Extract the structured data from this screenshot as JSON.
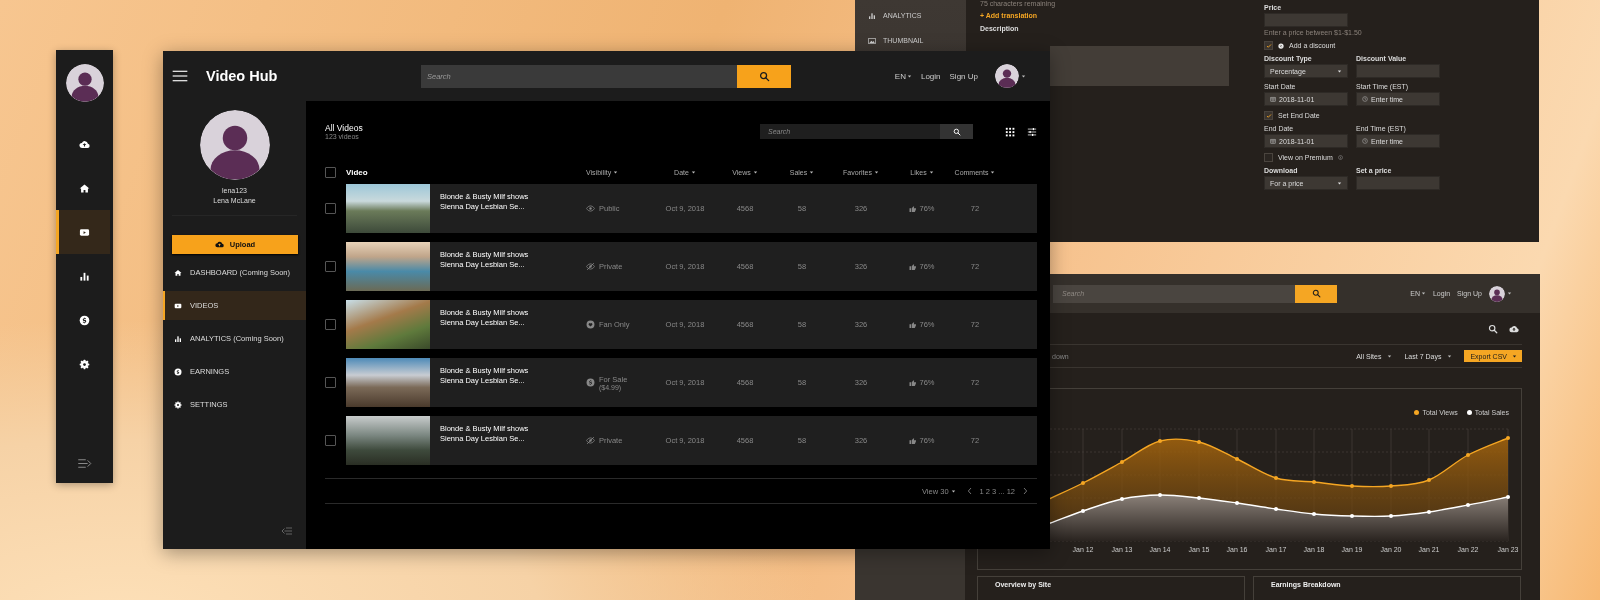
{
  "mini_sidebar": {
    "items": [
      {
        "kind": "upload",
        "selected": false
      },
      {
        "kind": "home",
        "selected": false
      },
      {
        "kind": "video",
        "selected": true
      },
      {
        "kind": "chart",
        "selected": false
      },
      {
        "kind": "earnings",
        "selected": false
      },
      {
        "kind": "settings",
        "selected": false
      }
    ]
  },
  "main": {
    "title": "Video Hub",
    "search": {
      "placeholder": "Search"
    },
    "language": "EN",
    "login": "Login",
    "signup": "Sign Up",
    "profile": {
      "username": "lena123",
      "name": "Lena McLane"
    },
    "upload_button": "Upload",
    "nav": [
      {
        "kind": "home",
        "label": "DASHBOARD (Coming Soon)",
        "selected": false
      },
      {
        "kind": "video",
        "label": "VIDEOS",
        "selected": true
      },
      {
        "kind": "chart",
        "label": "ANALYTICS  (Coming Soon)",
        "selected": false
      },
      {
        "kind": "earnings",
        "label": "EARNINGS",
        "selected": false
      },
      {
        "kind": "settings",
        "label": "SETTINGS",
        "selected": false
      }
    ],
    "list": {
      "title": "All Videos",
      "count": "123 videos",
      "search": {
        "placeholder": "Search"
      }
    },
    "table": {
      "columns": [
        "Video",
        "Visibility",
        "Date",
        "Views",
        "Sales",
        "Favorites",
        "Likes",
        "Comments"
      ],
      "header_checked": false,
      "rows": [
        {
          "checked": false,
          "title": [
            "Blonde & Busty Milf shows",
            "Sienna Day Lesbian Se..."
          ],
          "kind": "public",
          "visibility": "Public",
          "date": "Oct 9, 2018",
          "views": "4568",
          "sales": "58",
          "favorites": "326",
          "likes": "76%",
          "comments": "72"
        },
        {
          "checked": false,
          "title": [
            "Blonde & Busty Milf shows",
            "Sienna Day Lesbian Se..."
          ],
          "kind": "private",
          "visibility": "Private",
          "date": "Oct 9, 2018",
          "views": "4568",
          "sales": "58",
          "favorites": "326",
          "likes": "76%",
          "comments": "72"
        },
        {
          "checked": false,
          "title": [
            "Blonde & Busty Milf shows",
            "Sienna Day Lesbian Se..."
          ],
          "kind": "fan",
          "visibility": "Fan Only",
          "date": "Oct 9, 2018",
          "views": "4568",
          "sales": "58",
          "favorites": "326",
          "likes": "76%",
          "comments": "72"
        },
        {
          "checked": false,
          "title": [
            "Blonde & Busty Milf shows",
            "Sienna Day Lesbian Se..."
          ],
          "kind": "sale",
          "visibility": "For Sale",
          "price": "($4.99)",
          "date": "Oct 9, 2018",
          "views": "4568",
          "sales": "58",
          "favorites": "326",
          "likes": "76%",
          "comments": "72"
        },
        {
          "checked": false,
          "title": [
            "Blonde & Busty Milf shows",
            "Sienna Day Lesbian Se..."
          ],
          "kind": "private",
          "visibility": "Private",
          "date": "Oct 9, 2018",
          "views": "4568",
          "sales": "58",
          "favorites": "326",
          "likes": "76%",
          "comments": "72"
        }
      ]
    },
    "pagination": {
      "view": "View 30",
      "pages": "1 2 3 ... 12"
    }
  },
  "form": {
    "nav": [
      {
        "kind": "chart",
        "label": "ANALYTICS"
      },
      {
        "kind": "image",
        "label": "THUMBNAIL"
      }
    ],
    "chars_remaining": "75 characters remaining",
    "add_translation": "+ Add translation",
    "description_label": "Description",
    "price_label": "Price",
    "price_hint": "Enter a price between $1-$1.50",
    "discount": {
      "checked": true,
      "label": "Add a discount"
    },
    "discount_type": {
      "label": "Discount Type",
      "value": "Percentage"
    },
    "discount_value": {
      "label": "Discount Value"
    },
    "start_date": {
      "label": "Start Date",
      "value": "2018-11-01"
    },
    "start_time": {
      "label": "Start Time (EST)",
      "placeholder": "Enter time"
    },
    "end_toggle": {
      "checked": true,
      "label": "Set End Date"
    },
    "end_date": {
      "label": "End Date",
      "value": "2018-11-01"
    },
    "end_time": {
      "label": "End Time (EST)",
      "placeholder": "Enter time"
    },
    "premium": {
      "checked": false,
      "label": "View on Premium"
    },
    "download": {
      "label": "Download",
      "value": "For a price"
    },
    "set_price": {
      "label": "Set a price"
    }
  },
  "analytics": {
    "search": {
      "placeholder": "Search"
    },
    "language": "EN",
    "login": "Login",
    "signup": "Sign Up",
    "tab_fragment": "down",
    "filters": [
      "All Sites",
      "Last 7 Days"
    ],
    "export_button": "Export CSV",
    "legend": [
      {
        "label": "Total Views",
        "color": "#f5a623"
      },
      {
        "label": "Total Sales",
        "color": "#ffffff"
      }
    ],
    "x_labels": [
      "Jan 12",
      "Jan 13",
      "Jan 14",
      "Jan 15",
      "Jan 16",
      "Jan 17",
      "Jan 18",
      "Jan 19",
      "Jan 20",
      "Jan 21",
      "Jan 22",
      "Jan 23"
    ],
    "cards": [
      "Overview by Site",
      "Earnings Breakdown"
    ]
  }
}
